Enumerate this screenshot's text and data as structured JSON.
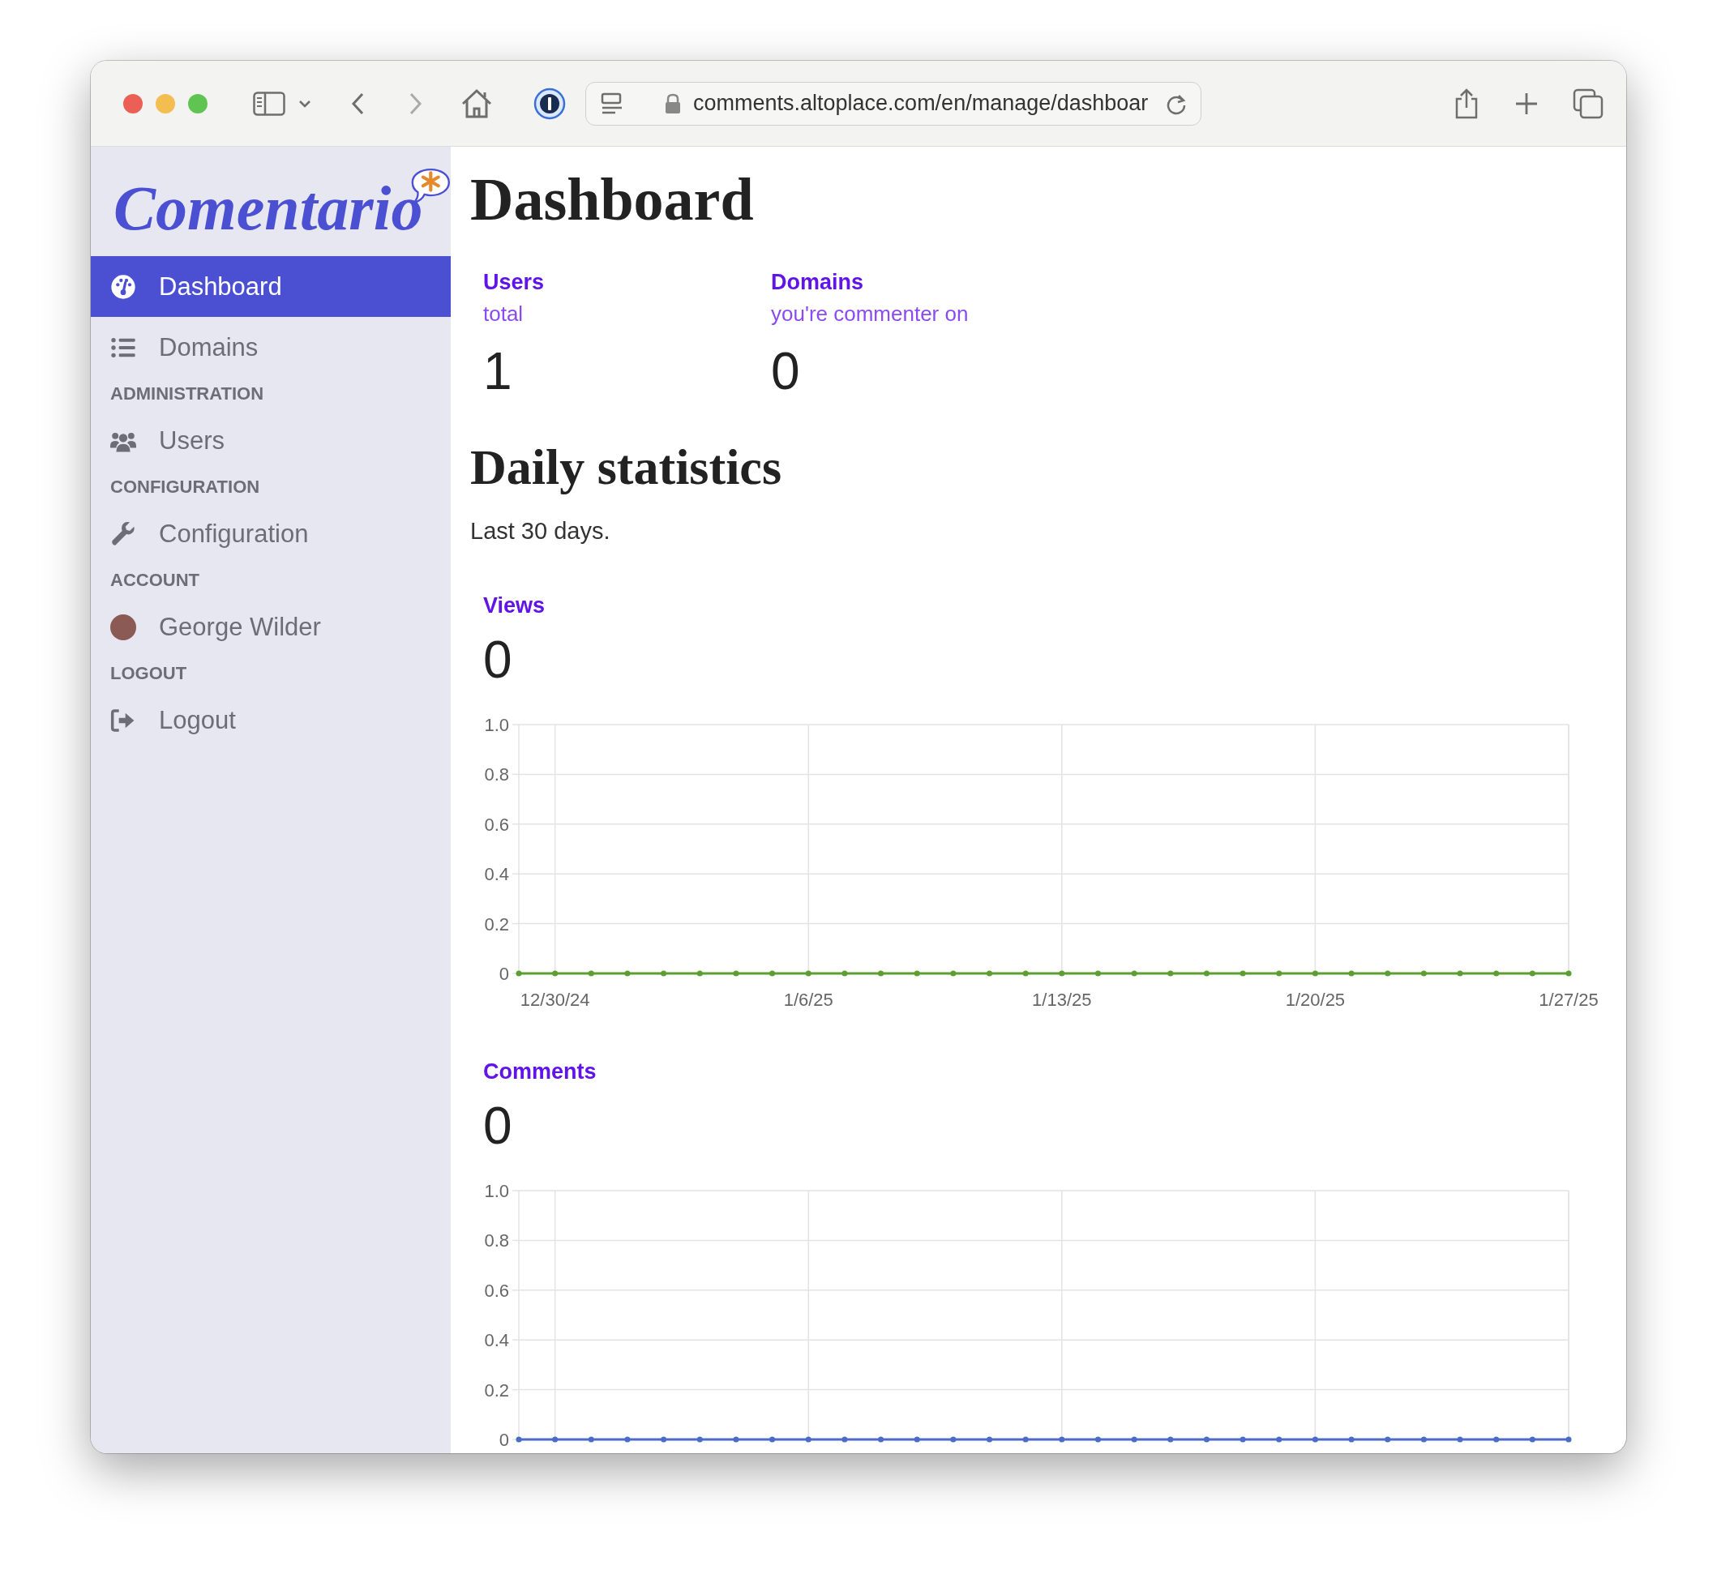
{
  "browser": {
    "url": "comments.altoplace.com/en/manage/dashboar"
  },
  "sidebar": {
    "logo": "Comentario",
    "nav": [
      {
        "kind": "item",
        "label": "Dashboard",
        "selected": true
      },
      {
        "kind": "item",
        "label": "Domains",
        "selected": false
      },
      {
        "kind": "heading",
        "label": "ADMINISTRATION"
      },
      {
        "kind": "item",
        "label": "Users",
        "selected": false
      },
      {
        "kind": "heading",
        "label": "CONFIGURATION"
      },
      {
        "kind": "item",
        "label": "Configuration",
        "selected": false
      },
      {
        "kind": "heading",
        "label": "ACCOUNT"
      },
      {
        "kind": "item",
        "label": "George Wilder",
        "selected": false
      },
      {
        "kind": "heading",
        "label": "LOGOUT"
      },
      {
        "kind": "item",
        "label": "Logout",
        "selected": false
      }
    ]
  },
  "main": {
    "title": "Dashboard",
    "stats": [
      {
        "label": "Users",
        "sublabel": "total",
        "value": "1"
      },
      {
        "label": "Domains",
        "sublabel": "you're commenter on",
        "value": "0"
      }
    ],
    "section_title": "Daily statistics",
    "note": "Last 30 days.",
    "charts": [
      {
        "total": "0",
        "chart_data": {
          "type": "line",
          "title": "Views",
          "categories": [
            null,
            "12/30/24",
            null,
            null,
            null,
            null,
            null,
            null,
            "1/6/25",
            null,
            null,
            null,
            null,
            null,
            null,
            "1/13/25",
            null,
            null,
            null,
            null,
            null,
            null,
            "1/20/25",
            null,
            null,
            null,
            null,
            null,
            null,
            "1/27/25"
          ],
          "ylim": [
            0,
            1
          ],
          "grid": true,
          "series": [
            {
              "color": "#5c9e31",
              "marker": "circle",
              "values": [
                0,
                0,
                0,
                0,
                0,
                0,
                0,
                0,
                0,
                0,
                0,
                0,
                0,
                0,
                0,
                0,
                0,
                0,
                0,
                0,
                0,
                0,
                0,
                0,
                0,
                0,
                0,
                0,
                0,
                0
              ]
            }
          ],
          "yticks": [
            {
              "value": 0,
              "label": "0"
            },
            {
              "value": 0.2,
              "label": "0.2"
            },
            {
              "value": 0.4,
              "label": "0.4"
            },
            {
              "value": 0.6,
              "label": "0.6"
            },
            {
              "value": 0.8,
              "label": "0.8"
            },
            {
              "value": 1,
              "label": "1.0"
            }
          ]
        }
      },
      {
        "total": "0",
        "chart_data": {
          "type": "line",
          "title": "Comments",
          "ylim": [
            0,
            1
          ],
          "grid": true,
          "series": [
            {
              "color": "#4a6cc4",
              "marker": "circle",
              "values": [
                0,
                0,
                0,
                0,
                0,
                0,
                0,
                0,
                0,
                0,
                0,
                0,
                0,
                0,
                0,
                0,
                0,
                0,
                0,
                0,
                0,
                0,
                0,
                0,
                0,
                0,
                0,
                0,
                0,
                0
              ]
            }
          ],
          "yticks": [
            {
              "value": 0,
              "label": "0"
            },
            {
              "value": 0.2,
              "label": "0.2"
            },
            {
              "value": 0.4,
              "label": "0.4"
            },
            {
              "value": 0.6,
              "label": "0.6"
            },
            {
              "value": 0.8,
              "label": "0.8"
            },
            {
              "value": 1,
              "label": "1.0"
            }
          ]
        }
      }
    ]
  }
}
